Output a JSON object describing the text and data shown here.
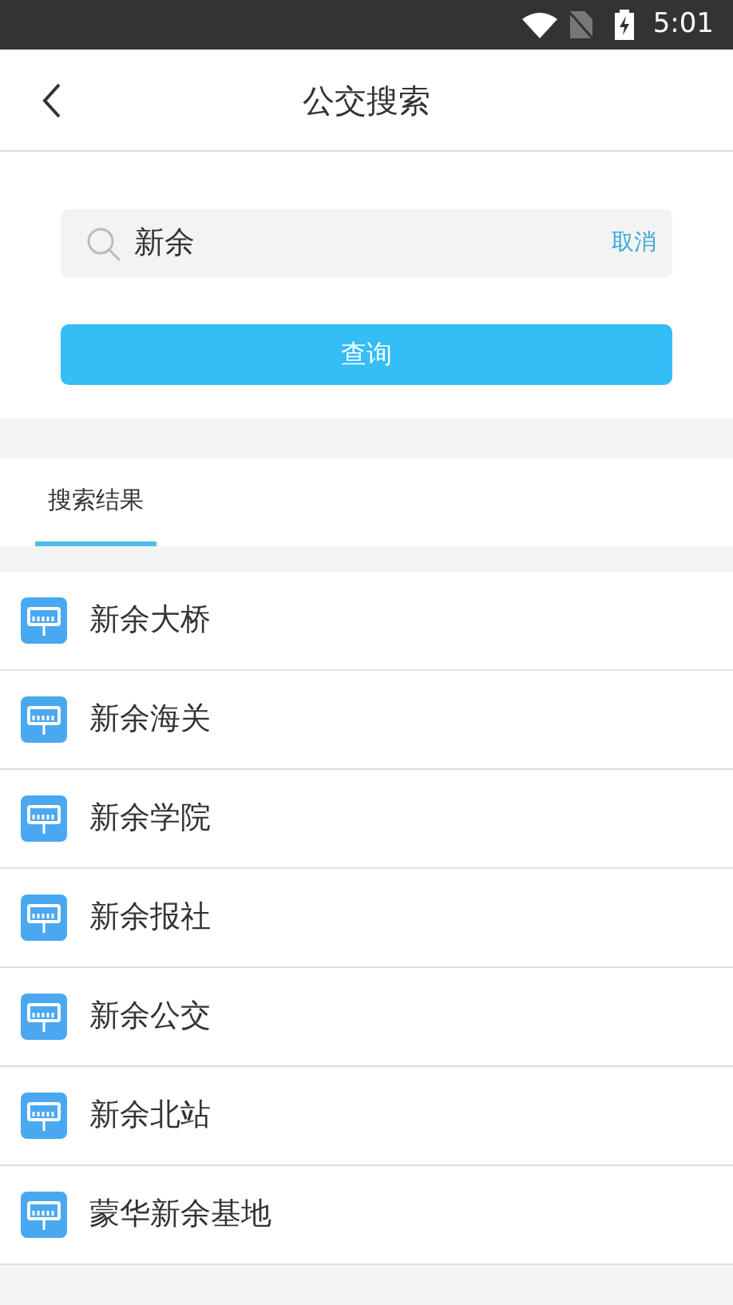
{
  "status_bar": {
    "time": "5:01"
  },
  "header": {
    "title": "公交搜索"
  },
  "search": {
    "value": "新余",
    "cancel": "取消",
    "button": "查询"
  },
  "tabs": [
    {
      "label": "搜索结果",
      "selected": true
    }
  ],
  "results": [
    {
      "name": "新余大桥"
    },
    {
      "name": "新余海关"
    },
    {
      "name": "新余学院"
    },
    {
      "name": "新余报社"
    },
    {
      "name": "新余公交"
    },
    {
      "name": "新余北站"
    },
    {
      "name": "蒙华新余基地"
    }
  ]
}
